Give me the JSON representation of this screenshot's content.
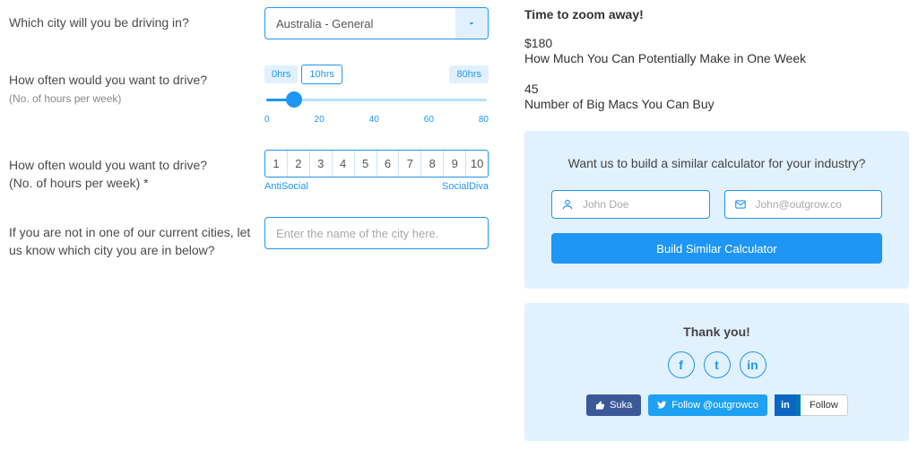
{
  "questions": {
    "city": {
      "label": "Which city will you be driving in?",
      "selected": "Australia - General"
    },
    "hours_slider": {
      "label": "How often would you want to drive?",
      "sub": "(No. of hours per week)",
      "min_label": "0hrs",
      "value_label": "10hrs",
      "max_label": "80hrs",
      "ticks": [
        "0",
        "20",
        "40",
        "60",
        "80"
      ]
    },
    "hours_rating": {
      "label": "How often would you want to drive?",
      "sub": "(No. of hours per week) *",
      "options": [
        "1",
        "2",
        "3",
        "4",
        "5",
        "6",
        "7",
        "8",
        "9",
        "10"
      ],
      "low": "AntiSocial",
      "high": "SocialDiva"
    },
    "other_city": {
      "label": "If you are not in one of our current cities, let us know which city you are in below?",
      "placeholder": "Enter the name of the city here."
    }
  },
  "results": {
    "headline": "Time to zoom away!",
    "metrics": [
      {
        "value": "$180",
        "desc": "How Much You Can Potentially Make in One Week"
      },
      {
        "value": "45",
        "desc": "Number of Big Macs You Can Buy"
      }
    ]
  },
  "cta": {
    "prompt": "Want us to build a similar calculator for your industry?",
    "name_placeholder": "John Doe",
    "email_placeholder": "John@outgrow.co",
    "button": "Build Similar Calculator"
  },
  "thanks": {
    "title": "Thank you!",
    "like_label": "Suka",
    "follow_label": "Follow @outgrowco",
    "li_label": "Follow"
  }
}
